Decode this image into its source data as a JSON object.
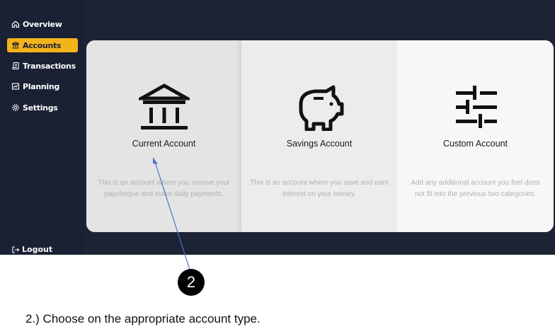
{
  "sidebar": {
    "items": [
      {
        "label": "Overview",
        "icon": "home-icon",
        "active": false
      },
      {
        "label": "Accounts",
        "icon": "bank-icon",
        "active": true
      },
      {
        "label": "Transactions",
        "icon": "receipt-icon",
        "active": false
      },
      {
        "label": "Planning",
        "icon": "chart-icon",
        "active": false
      },
      {
        "label": "Settings",
        "icon": "gear-icon",
        "active": false
      }
    ],
    "logout_label": "Logout"
  },
  "cards": [
    {
      "title": "Current Account",
      "icon": "bank-icon",
      "description": "This is an account where you receive your paycheque and make daily payments."
    },
    {
      "title": "Savings Account",
      "icon": "piggy-bank-icon",
      "description": "This is an account where you save and earn interest on your money."
    },
    {
      "title": "Custom Account",
      "icon": "sliders-icon",
      "description": "Add any additional account you feel does not fit into the previous two categories."
    }
  ],
  "annotation": {
    "step_number": "2",
    "instruction": "2.) Choose on the appropriate account type."
  },
  "colors": {
    "sidebar_bg": "#1a2135",
    "active_accent": "#f3b31a",
    "arrow": "#4a76c8"
  }
}
